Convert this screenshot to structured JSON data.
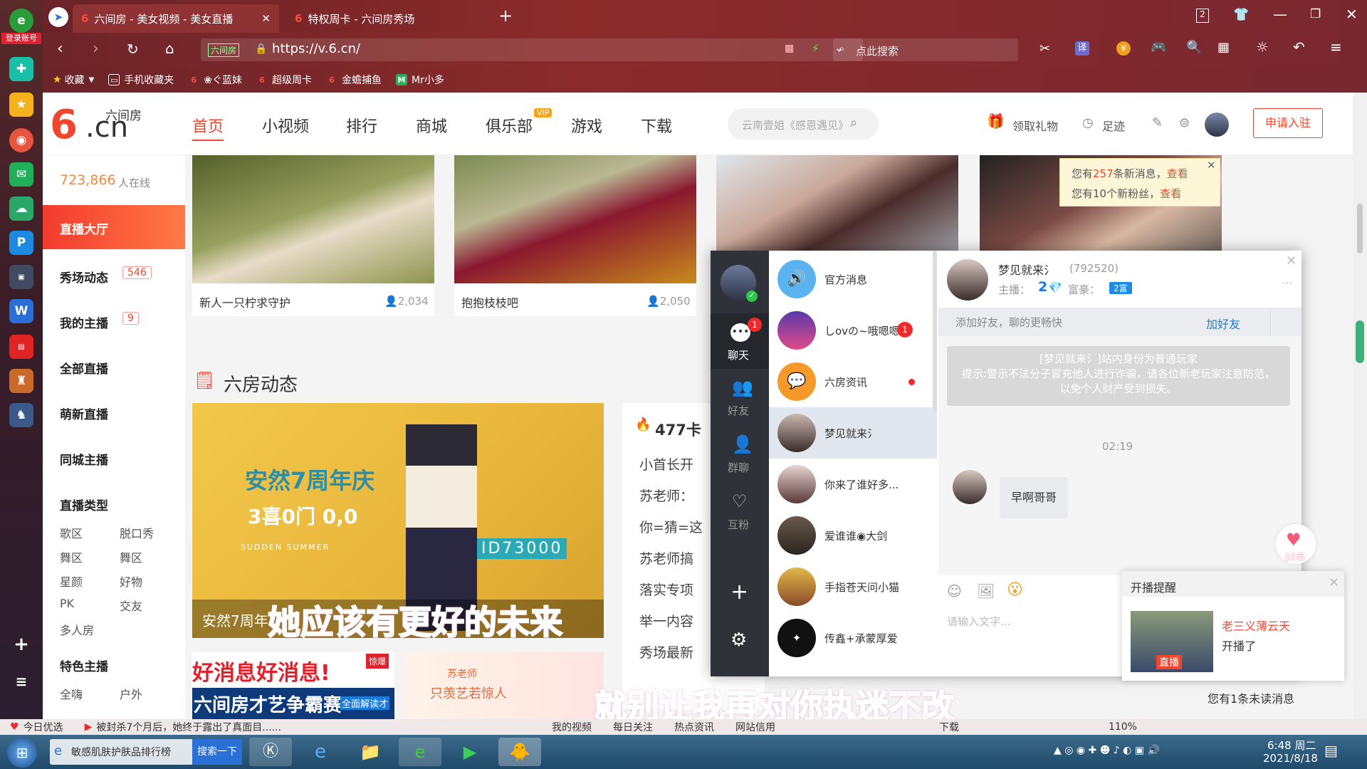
{
  "leftbar": {
    "login_label": "登录账号"
  },
  "tabs": [
    {
      "label": "六间房 - 美女视频 - 美女直播"
    },
    {
      "label": "特权周卡 - 六间房秀场"
    }
  ],
  "tab_counter": "2",
  "address": {
    "site_badge": "六间房",
    "url": "https://v.6.cn/",
    "search_placeholder": "点此搜索",
    "translate": "译"
  },
  "bookmarks": [
    "收藏",
    "手机收藏夹",
    "❀ぐ蓝妹",
    "超级周卡",
    "金蟾捕鱼",
    "Mr小多"
  ],
  "site": {
    "logo_text": "六间房",
    "logo_domain": ".cn",
    "nav": [
      "首页",
      "小视频",
      "排行",
      "商城",
      "俱乐部",
      "游戏",
      "下载"
    ],
    "nav_vip": "VIP",
    "search_placeholder": "云南壹姐《感恩遇见》",
    "gift": "领取礼物",
    "footprint": "足迹",
    "apply": "申请入驻"
  },
  "sidebar": {
    "online_count": "723,866",
    "online_label": "人在线",
    "hall": "直播大厅",
    "show": "秀场动态",
    "show_badge": "546",
    "my": "我的主播",
    "my_badge": "9",
    "all": "全部直播",
    "cute": "萌新直播",
    "city": "同城主播",
    "types_title": "直播类型",
    "types": [
      "歌区",
      "脱口秀",
      "舞区",
      "舞区",
      "星颜",
      "好物",
      "PK",
      "交友",
      "多人房"
    ],
    "special": "特色主播",
    "more": [
      "全嗨",
      "户外"
    ]
  },
  "cards": [
    {
      "title": "新人一只柠求守护",
      "count": "2,034"
    },
    {
      "title": "抱抱枝枝吧",
      "count": "2,050"
    }
  ],
  "notice": {
    "line1_pre": "您有",
    "line1_num": "257",
    "line1_mid": "条新消息，",
    "line1_link": "查看",
    "line2_pre": "您有10个新粉丝，",
    "line2_link": "查看"
  },
  "feed": {
    "section": "六房动态",
    "banner_title": "安然7周年庆",
    "banner_sub": "3喜0门  0,0",
    "banner_id": "ID73000",
    "banner_en": "SUDDEN SUMMER",
    "banner_caption": "安然7周年",
    "hot_title": "477卡",
    "hot_items": [
      "小首长开",
      "苏老师：",
      "你=猜=这",
      "苏老师搞",
      "落实专项",
      "举一内容",
      "秀场最新"
    ],
    "promo1": "好消息好消息!",
    "promo1_tag": "惊爆",
    "promo2": "六间房才艺争霸赛",
    "promo2_side": "全面解读才",
    "promo3": "苏老师",
    "promo3_sub": "只羡艺若惊人"
  },
  "chat": {
    "nav_badge": "1",
    "nav": [
      "聊天",
      "好友",
      "群聊",
      "互粉"
    ],
    "list": [
      {
        "name": "官方消息"
      },
      {
        "name": "しovの~哦嗯嗯",
        "badge": "1"
      },
      {
        "name": "六房资讯"
      },
      {
        "name": "梦见就来氵"
      },
      {
        "name": "你来了谁好多..."
      },
      {
        "name": "爱谁谁◉大剑"
      },
      {
        "name": "手指苍天问小猫"
      },
      {
        "name": "传鑫+承蒙厚爱"
      }
    ],
    "peer_name": "梦见就来氵",
    "peer_id": "(792520)",
    "anchor_label": "主播：",
    "anchor_level": "2",
    "rich_label": "富豪：",
    "rich_level": "2富",
    "add_hint": "添加好友，聊的更畅快",
    "add_btn": "加好友",
    "sys_line1": "[梦见就来氵]站内身份为普通玩家",
    "sys_line2": "提示:警示不法分子冒充他人进行诈骗，请各位新老玩家注意防范，以免个人财产受到损失。",
    "time": "02:19",
    "msg": "早啊哥哥",
    "input_placeholder": "请输入文字...",
    "coin": "10币"
  },
  "live_notice": {
    "title": "开播提醒",
    "name": "老三义薄云天",
    "action": "开播了",
    "badge": "直播",
    "unread": "您有1条未读消息"
  },
  "subtitles": [
    "她应该有更好的未来",
    "就别让我再对你执迷不改"
  ],
  "status_bar": {
    "pick": "今日优选",
    "news": "被封杀7个月后，她终于露出了真面目......",
    "items": [
      "我的视频",
      "每日关注",
      "热点资讯",
      "网站信用",
      "下载"
    ],
    "zoom": "110%"
  },
  "taskbar": {
    "task1": "敏感肌肤护肤品排行榜",
    "task1_btn": "搜索一下",
    "time": "6:48 周二",
    "date": "2021/8/18"
  }
}
